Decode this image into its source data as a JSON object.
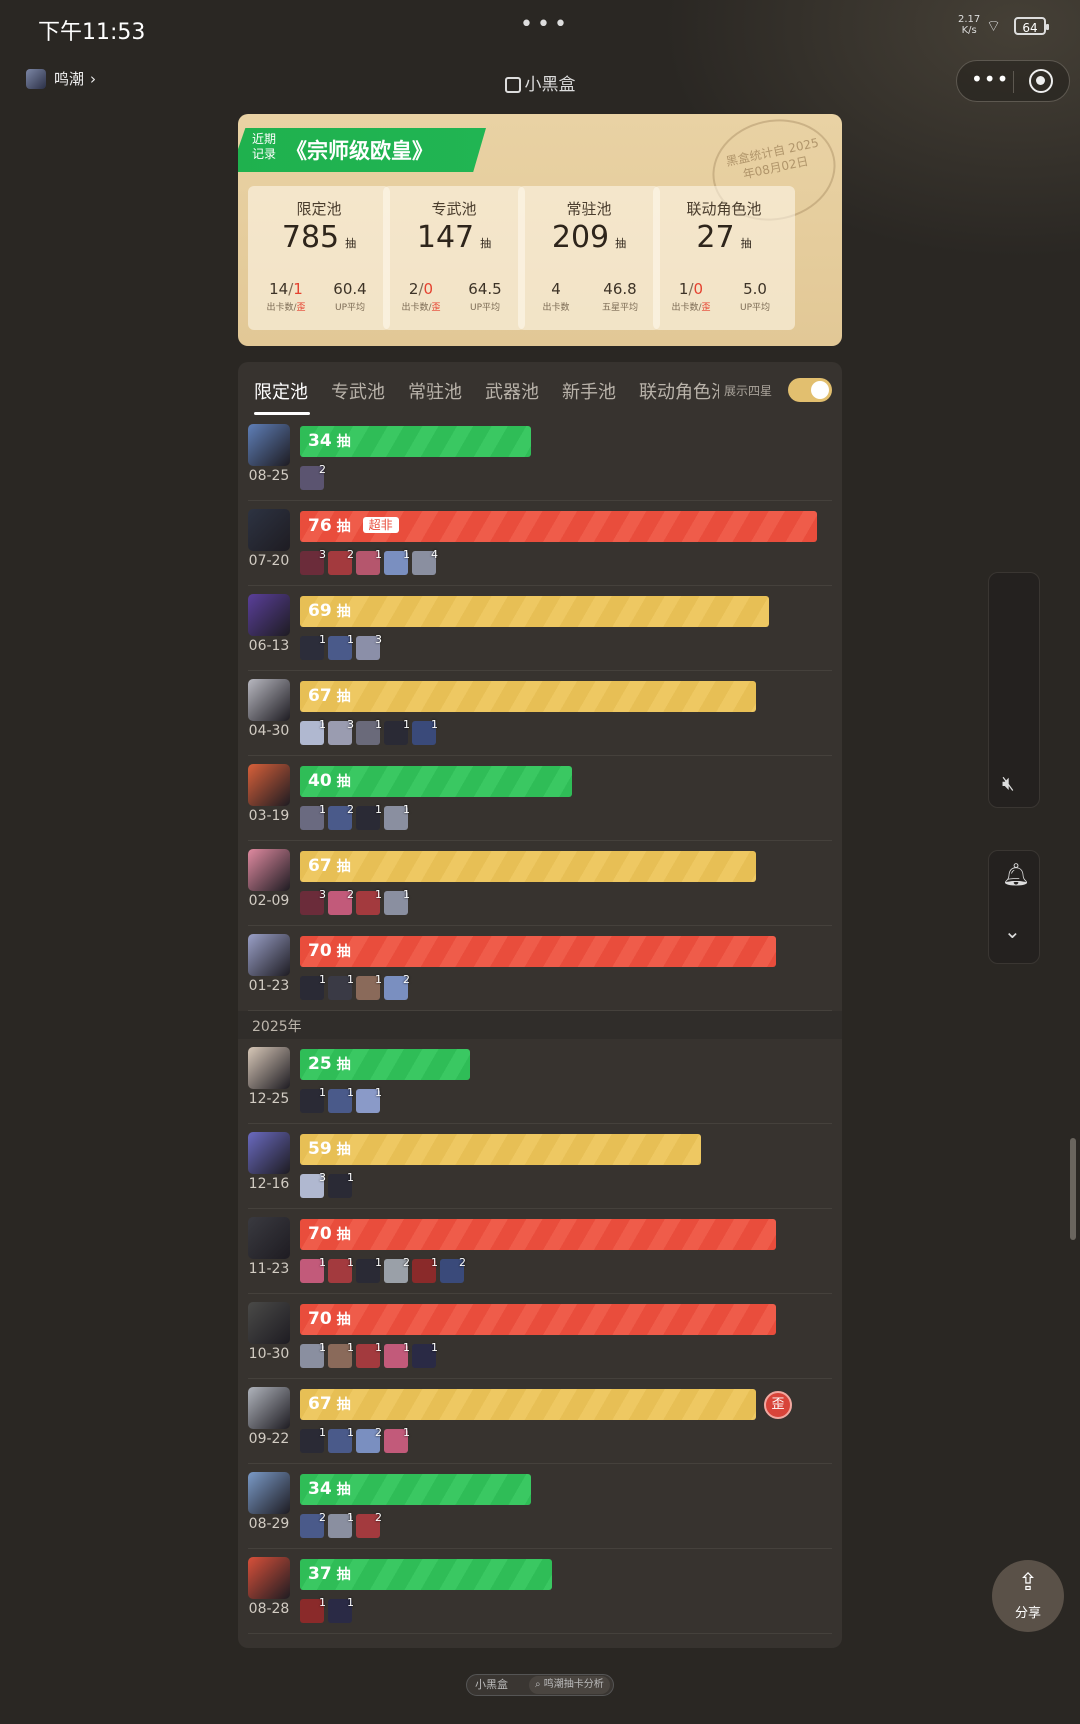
{
  "status_bar": {
    "time": "下午11:53",
    "dots": "•••",
    "net_speed_value": "2.17",
    "net_speed_unit": "K/s",
    "wifi_icon": "wifi-icon",
    "battery": "64"
  },
  "header": {
    "back_label": "鸣潮",
    "app_title": "小黑盒",
    "more_icon": "•••"
  },
  "summary": {
    "banner_small": "近期 记录",
    "banner_title": "《宗师级欧皇》",
    "stamp_text": "黑盒统计自 2025年08月02日",
    "pools": [
      {
        "title": "限定池",
        "count": "785",
        "unit": "抽",
        "left_value_a": "14",
        "left_value_b": "1",
        "left_label_a": "出卡数/",
        "left_label_b": "歪",
        "right_value": "60.4",
        "right_label": "UP平均"
      },
      {
        "title": "专武池",
        "count": "147",
        "unit": "抽",
        "left_value_a": "2",
        "left_value_b": "0",
        "left_label_a": "出卡数/",
        "left_label_b": "歪",
        "right_value": "64.5",
        "right_label": "UP平均"
      },
      {
        "title": "常驻池",
        "count": "209",
        "unit": "抽",
        "left_value_a": "4",
        "left_value_b": "",
        "left_label_a": "出卡数",
        "left_label_b": "",
        "right_value": "46.8",
        "right_label": "五星平均"
      },
      {
        "title": "联动角色池",
        "count": "27",
        "unit": "抽",
        "left_value_a": "1",
        "left_value_b": "0",
        "left_label_a": "出卡数/",
        "left_label_b": "歪",
        "right_value": "5.0",
        "right_label": "UP平均"
      }
    ]
  },
  "tabs": [
    "限定池",
    "专武池",
    "常驻池",
    "武器池",
    "新手池",
    "联动角色池"
  ],
  "toggle_label": "展示四星",
  "unit": "抽",
  "year_label": "2025年",
  "pulls": [
    {
      "date": "08-25",
      "pulls": "34",
      "color": "green",
      "tag": "",
      "wai": "",
      "avatar_color": "#5f7fb8",
      "chips": [
        {
          "c": "#5b5470",
          "n": "2"
        }
      ]
    },
    {
      "date": "07-20",
      "pulls": "76",
      "color": "red",
      "tag": "超非",
      "wai": "",
      "avatar_color": "#2d3342",
      "chips": [
        {
          "c": "#6b2c3a",
          "n": "3"
        },
        {
          "c": "#a33a3e",
          "n": "2"
        },
        {
          "c": "#b5566d",
          "n": "1"
        },
        {
          "c": "#7a8fc0",
          "n": "1"
        },
        {
          "c": "#8a8fa0",
          "n": "4"
        }
      ]
    },
    {
      "date": "06-13",
      "pulls": "69",
      "color": "yellow",
      "tag": "",
      "wai": "",
      "avatar_color": "#5a3f9a",
      "chips": [
        {
          "c": "#2c2d3a",
          "n": "1"
        },
        {
          "c": "#4a5a8a",
          "n": "1"
        },
        {
          "c": "#8b8fa8",
          "n": "3"
        }
      ]
    },
    {
      "date": "04-30",
      "pulls": "67",
      "color": "yellow",
      "tag": "",
      "wai": "",
      "avatar_color": "#b8b8c0",
      "chips": [
        {
          "c": "#b0b8d0",
          "n": "1"
        },
        {
          "c": "#9a9cb0",
          "n": "3"
        },
        {
          "c": "#6a6a7a",
          "n": "1"
        },
        {
          "c": "#2a2a35",
          "n": "1"
        },
        {
          "c": "#3a4a7a",
          "n": "1"
        }
      ]
    },
    {
      "date": "03-19",
      "pulls": "40",
      "color": "green",
      "tag": "",
      "wai": "",
      "avatar_color": "#d8603a",
      "chips": [
        {
          "c": "#6a6a80",
          "n": "1"
        },
        {
          "c": "#4a5a8a",
          "n": "2"
        },
        {
          "c": "#2a2a35",
          "n": "1"
        },
        {
          "c": "#8a8fa0",
          "n": "1"
        }
      ]
    },
    {
      "date": "02-09",
      "pulls": "67",
      "color": "yellow",
      "tag": "",
      "wai": "",
      "avatar_color": "#e08aa0",
      "chips": [
        {
          "c": "#6b2c3a",
          "n": "3"
        },
        {
          "c": "#c25a7a",
          "n": "2"
        },
        {
          "c": "#a33a3e",
          "n": "1"
        },
        {
          "c": "#8a8fa0",
          "n": "1"
        }
      ]
    },
    {
      "date": "01-23",
      "pulls": "70",
      "color": "red",
      "tag": "",
      "wai": "",
      "avatar_color": "#9aa0c8",
      "chips": [
        {
          "c": "#2a2a35",
          "n": "1"
        },
        {
          "c": "#3a3a45",
          "n": "1"
        },
        {
          "c": "#8a6a5a",
          "n": "1"
        },
        {
          "c": "#7a8fc0",
          "n": "2"
        }
      ]
    },
    {
      "date": "12-25",
      "pulls": "25",
      "color": "green",
      "tag": "",
      "wai": "",
      "avatar_color": "#d8c8b8",
      "chips": [
        {
          "c": "#2a2a35",
          "n": "1"
        },
        {
          "c": "#4a5a8a",
          "n": "1"
        },
        {
          "c": "#8a9ac8",
          "n": "1"
        }
      ]
    },
    {
      "date": "12-16",
      "pulls": "59",
      "color": "yellow",
      "tag": "",
      "wai": "",
      "avatar_color": "#6a6ac0",
      "chips": [
        {
          "c": "#b0b8d0",
          "n": "3"
        },
        {
          "c": "#2a2a35",
          "n": "1"
        }
      ]
    },
    {
      "date": "11-23",
      "pulls": "70",
      "color": "red",
      "tag": "",
      "wai": "",
      "avatar_color": "#3a3a40",
      "chips": [
        {
          "c": "#c25a7a",
          "n": "1"
        },
        {
          "c": "#a33a3e",
          "n": "1"
        },
        {
          "c": "#2a2a35",
          "n": "1"
        },
        {
          "c": "#9aa0a8",
          "n": "2"
        },
        {
          "c": "#8a2a2a",
          "n": "1"
        },
        {
          "c": "#3a4a7a",
          "n": "2"
        }
      ]
    },
    {
      "date": "10-30",
      "pulls": "70",
      "color": "red",
      "tag": "",
      "wai": "",
      "avatar_color": "#4a4a48",
      "chips": [
        {
          "c": "#8a8fa0",
          "n": "1"
        },
        {
          "c": "#8a6a5a",
          "n": "1"
        },
        {
          "c": "#a33a3e",
          "n": "1"
        },
        {
          "c": "#c25a7a",
          "n": "1"
        },
        {
          "c": "#2a2a45",
          "n": "1"
        }
      ]
    },
    {
      "date": "09-22",
      "pulls": "67",
      "color": "yellow",
      "tag": "",
      "wai": "歪",
      "avatar_color": "#b0b4bc",
      "chips": [
        {
          "c": "#2a2a35",
          "n": "1"
        },
        {
          "c": "#4a5a8a",
          "n": "1"
        },
        {
          "c": "#7a8fc0",
          "n": "2"
        },
        {
          "c": "#c25a7a",
          "n": "1"
        }
      ]
    },
    {
      "date": "08-29",
      "pulls": "34",
      "color": "green",
      "tag": "",
      "wai": "",
      "avatar_color": "#7a9ac8",
      "chips": [
        {
          "c": "#4a5a8a",
          "n": "2"
        },
        {
          "c": "#8a8fa0",
          "n": "1"
        },
        {
          "c": "#a33a3e",
          "n": "2"
        }
      ]
    },
    {
      "date": "08-28",
      "pulls": "37",
      "color": "green",
      "tag": "",
      "wai": "",
      "avatar_color": "#d8503a",
      "chips": [
        {
          "c": "#8a2a2a",
          "n": "1"
        },
        {
          "c": "#2a2a45",
          "n": "1"
        }
      ]
    }
  ],
  "share_label": "分享",
  "footer": {
    "brand": "小黑盒",
    "search": "鸣潮抽卡分析"
  }
}
